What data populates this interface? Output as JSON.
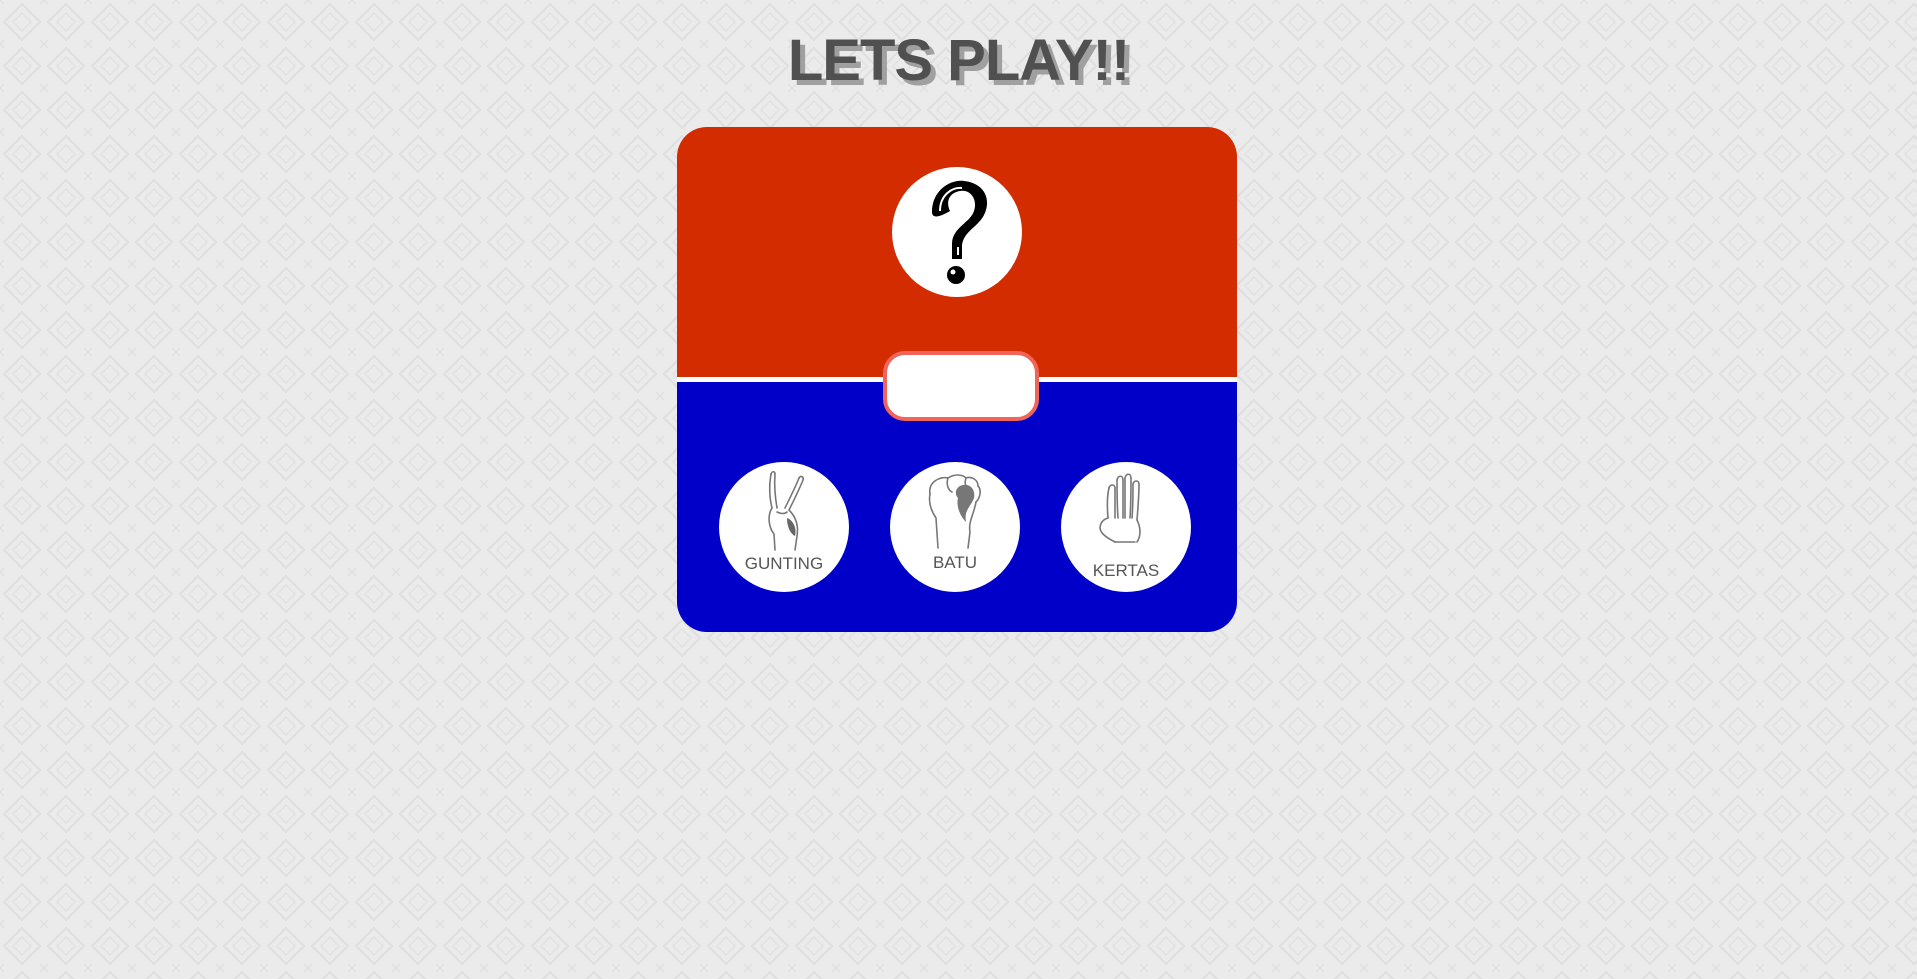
{
  "page": {
    "title": "LETS PLAY!!",
    "background_color": "#ebebeb"
  },
  "board": {
    "top_color": "#d22c00",
    "bottom_color": "#0000c8",
    "computer_choice": {
      "icon": "question-mark-icon"
    },
    "result": {
      "text": "",
      "border_color": "#f0645a"
    },
    "player_choices": [
      {
        "label": "GUNTING",
        "icon": "scissors-hand-icon"
      },
      {
        "label": "BATU",
        "icon": "rock-fist-icon"
      },
      {
        "label": "KERTAS",
        "icon": "paper-hand-icon"
      }
    ]
  }
}
